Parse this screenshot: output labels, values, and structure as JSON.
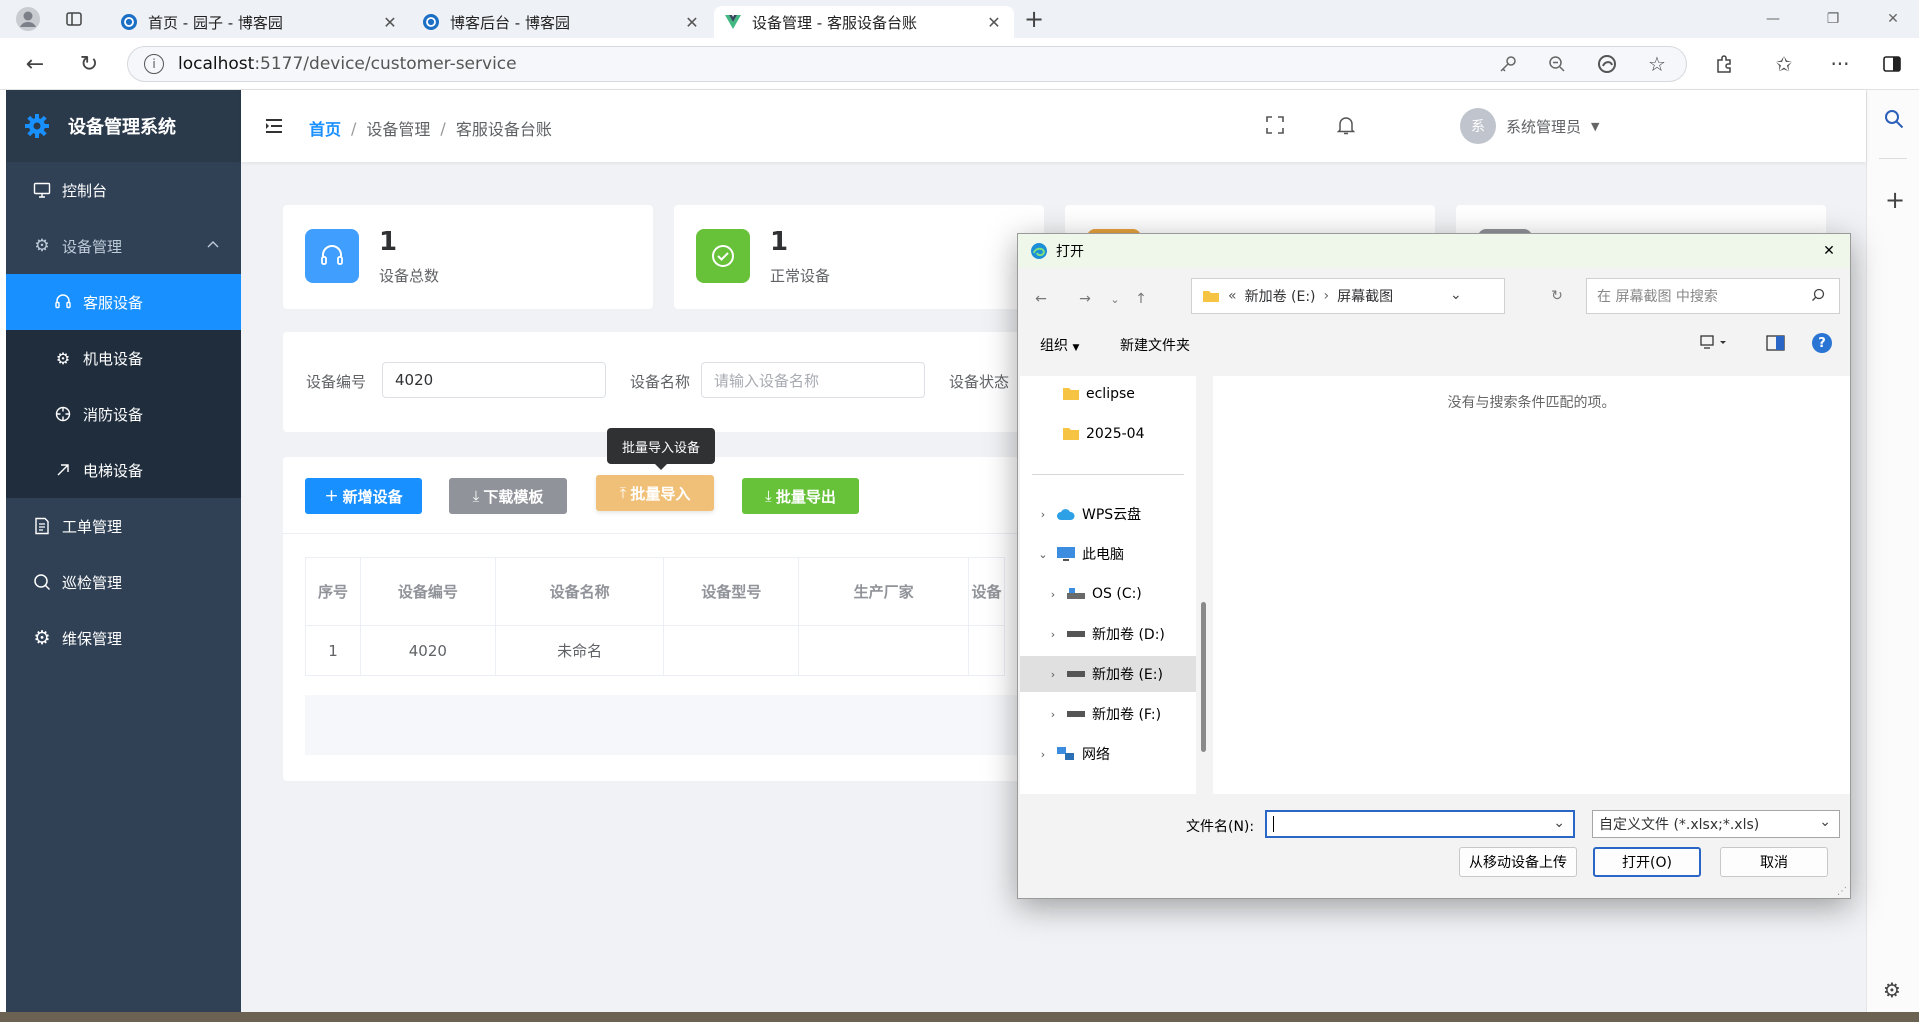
{
  "browser": {
    "tabs": [
      {
        "title": "首页 - 园子 - 博客园"
      },
      {
        "title": "博客后台 - 博客园"
      },
      {
        "title": "设备管理 - 客服设备台账"
      }
    ],
    "url_host": "localhost",
    "url_path": ":5177/device/customer-service"
  },
  "app": {
    "title": "设备管理系统",
    "menu": {
      "dashboard": "控制台",
      "device_mgmt": "设备管理",
      "customer": "客服设备",
      "electro": "机电设备",
      "fire": "消防设备",
      "elevator": "电梯设备",
      "workorder": "工单管理",
      "patrol": "巡检管理",
      "maintain": "维保管理"
    },
    "breadcrumb": [
      "首页",
      "设备管理",
      "客服设备台账"
    ],
    "user": {
      "avatar": "系",
      "name": "系统管理员"
    }
  },
  "stats": [
    {
      "value": "1",
      "label": "设备总数"
    },
    {
      "value": "1",
      "label": "正常设备"
    }
  ],
  "search": {
    "code_label": "设备编号",
    "code_value": "4020",
    "name_label": "设备名称",
    "name_placeholder": "请输入设备名称",
    "status_label": "设备状态"
  },
  "toolbar": {
    "add": "新增设备",
    "download": "下载模板",
    "import": "批量导入",
    "export": "批量导出",
    "tooltip": "批量导入设备"
  },
  "table": {
    "headers": [
      "序号",
      "设备编号",
      "设备名称",
      "设备型号",
      "生产厂家",
      "设备"
    ],
    "rows": [
      [
        "1",
        "4020",
        "未命名",
        "",
        "",
        ""
      ]
    ]
  },
  "dialog": {
    "title": "打开",
    "path": [
      "新加卷 (E:)",
      "屏幕截图"
    ],
    "search_placeholder": "在 屏幕截图 中搜索",
    "organize": "组织",
    "new_folder": "新建文件夹",
    "nav": {
      "eclipse": "eclipse",
      "f2025": "2025-04",
      "wps": "WPS云盘",
      "pc": "此电脑",
      "c": "OS (C:)",
      "d": "新加卷 (D:)",
      "e": "新加卷 (E:)",
      "f": "新加卷 (F:)",
      "net": "网络"
    },
    "empty_text": "没有与搜索条件匹配的项。",
    "filename_label": "文件名(N):",
    "filetype": "自定义文件 (*.xlsx;*.xls)",
    "upload_mobile": "从移动设备上传",
    "open": "打开(O)",
    "cancel": "取消"
  },
  "colors": {
    "primary": "#1890ff",
    "sidebar": "#304156",
    "success": "#67c23a",
    "warning": "#f0c078",
    "info": "#909399"
  }
}
